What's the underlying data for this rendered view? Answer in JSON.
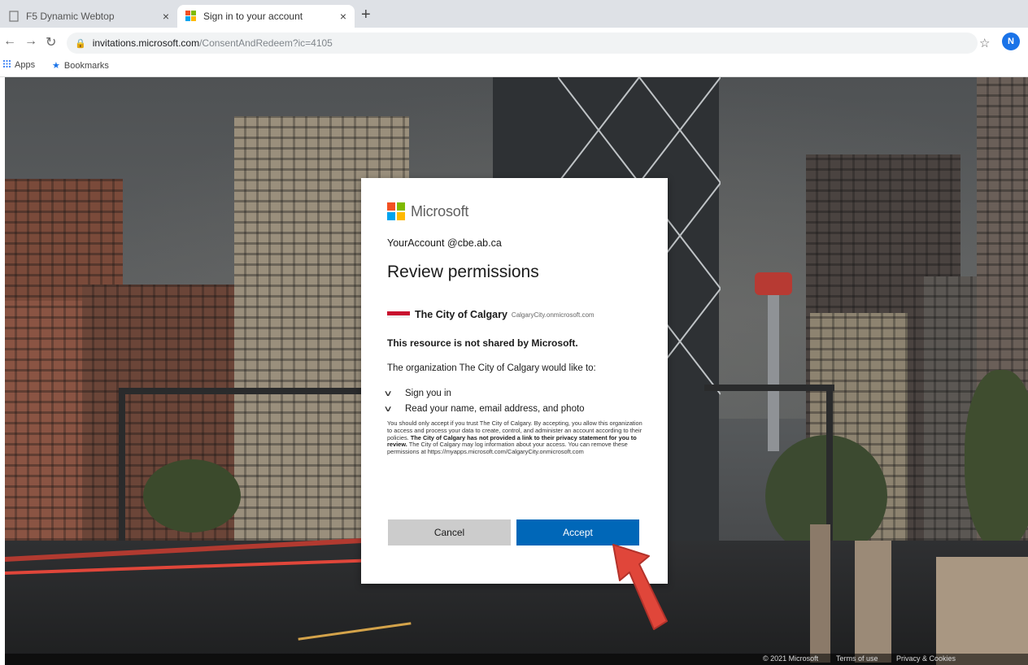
{
  "browser": {
    "tabs": [
      {
        "title": "F5 Dynamic Webtop",
        "active": false
      },
      {
        "title": "Sign in to your account",
        "active": true
      }
    ],
    "new_tab_label": "+",
    "close_label": "×",
    "url_host": "invitations.microsoft.com",
    "url_path": "/ConsentAndRedeem?ic=4105",
    "profile_initial": "N",
    "bookmarks": [
      {
        "label": "Apps",
        "icon": "apps-grid-icon"
      },
      {
        "label": "Bookmarks",
        "icon": "star-icon"
      }
    ]
  },
  "dialog": {
    "brand": "Microsoft",
    "brand_colors": [
      "#f25022",
      "#7fba00",
      "#00a4ef",
      "#ffb900"
    ],
    "account": "YourAccount @cbe.ab.ca",
    "heading": "Review permissions",
    "app_name": "The City of Calgary",
    "app_domain": "CalgaryCity.onmicrosoft.com",
    "notice": "This resource is not shared by Microsoft.",
    "org_line": "The organization The City of Calgary would like to:",
    "permissions": [
      "Sign you in",
      "Read your name, email address, and photo"
    ],
    "fine_print_1": "You should only accept if you trust The City of Calgary. By accepting, you allow this organization to access and process your data to create, control, and administer an account according to their policies.",
    "fine_print_bold": "The City of Calgary has not provided a link to their privacy statement for you to review.",
    "fine_print_2": "The City of Calgary may log information about your access. You can remove these permissions at https://myapps.microsoft.com/CalgaryCity.onmicrosoft.com",
    "cancel_label": "Cancel",
    "accept_label": "Accept",
    "accent_color": "#0067b8"
  },
  "footer": {
    "copyright": "© 2021 Microsoft",
    "terms": "Terms of use",
    "privacy": "Privacy & Cookies"
  }
}
